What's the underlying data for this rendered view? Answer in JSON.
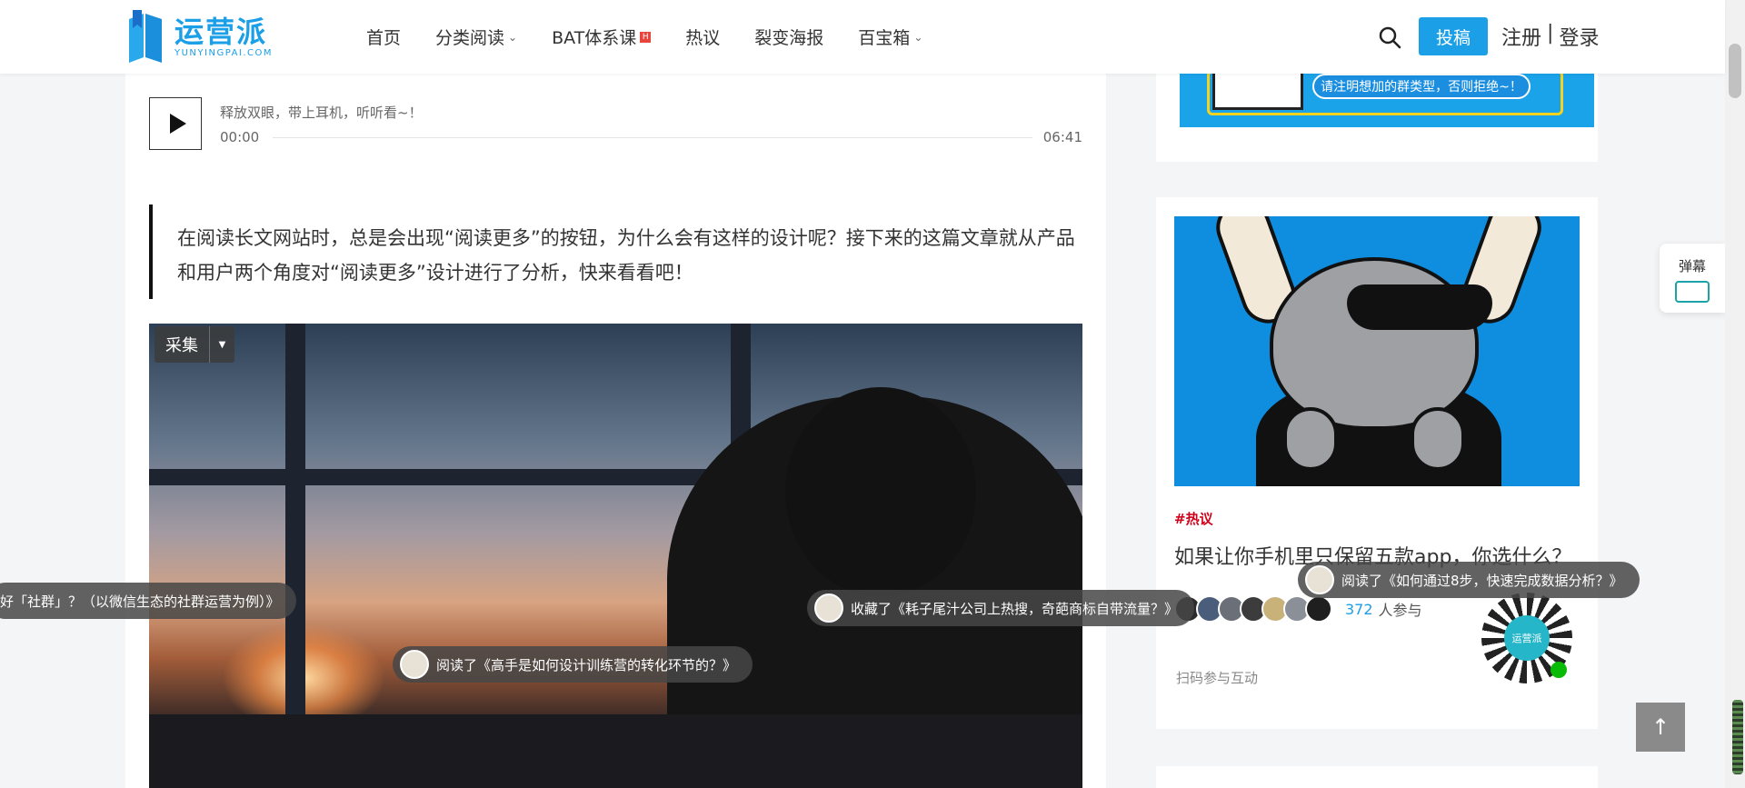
{
  "brand": {
    "name_cn": "运营派",
    "name_en": "YUNYINGPAI.COM",
    "color": "#1b9fe7"
  },
  "nav": {
    "items": [
      {
        "label": "首页",
        "chevron": false,
        "badge": false
      },
      {
        "label": "分类阅读",
        "chevron": true,
        "badge": false
      },
      {
        "label": "BAT体系课",
        "chevron": false,
        "badge": true
      },
      {
        "label": "热议",
        "chevron": false,
        "badge": false
      },
      {
        "label": "裂变海报",
        "chevron": false,
        "badge": false
      },
      {
        "label": "百宝箱",
        "chevron": true,
        "badge": false
      }
    ],
    "badge_text": "H",
    "submit_label": "投稿",
    "register_label": "注册",
    "auth_separator": "|",
    "login_label": "登录"
  },
  "player": {
    "title": "释放双眼，带上耳机，听听看~！",
    "current_time": "00:00",
    "duration": "06:41"
  },
  "article": {
    "quote": "在阅读长文网站时，总是会出现“阅读更多”的按钮，为什么会有这样的设计呢？接下来的这篇文章就从产品和用户两个角度对“阅读更多”设计进行了分析，快来看看吧！",
    "collect_label": "采集"
  },
  "danmaku": [
    {
      "text": "好「社群」？（以微信生态的社群运营为例）》"
    },
    {
      "text": "收藏了《耗子尾汁公司上热搜，奇葩商标自带流量？》"
    },
    {
      "text": "阅读了《高手是如何设计训练营的转化环节的？》"
    },
    {
      "text": "阅读了《如何通过8步，快速完成数据分析？》"
    }
  ],
  "sidebar": {
    "banner_msg": "请注明想加的群类型，否则拒绝~！",
    "card": {
      "tag": "#热议",
      "title": "如果让你手机里只保留五款app，你选什么？",
      "participant_count": "372",
      "participant_suffix": "人参与",
      "scan_text": "扫码参与互动",
      "qr_center": "运营派"
    }
  },
  "widgets": {
    "danmu_label": "弹幕",
    "back_to_top": "↑"
  }
}
